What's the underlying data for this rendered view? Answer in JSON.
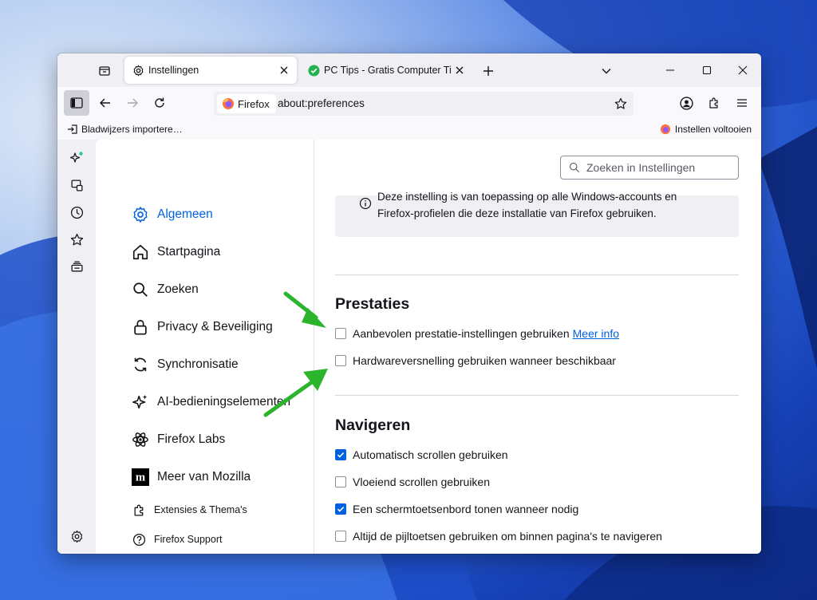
{
  "colors": {
    "accent": "#0061e0",
    "arrow": "#2db42d",
    "tab_check": "#22b14c"
  },
  "tabs": [
    {
      "title": "Instellingen",
      "icon": "gear-icon",
      "active": true
    },
    {
      "title": "PC Tips - Gratis Computer Tips,",
      "icon": "check-circle-icon",
      "active": false
    }
  ],
  "urlbar": {
    "identity_label": "Firefox",
    "url": "about:preferences"
  },
  "bookmarks": {
    "import_label": "Bladwijzers importere…",
    "finish_setup_label": "Instellen voltooien"
  },
  "categories": [
    {
      "label": "Algemeen",
      "icon": "gear-icon",
      "selected": true
    },
    {
      "label": "Startpagina",
      "icon": "home-icon"
    },
    {
      "label": "Zoeken",
      "icon": "search-icon"
    },
    {
      "label": "Privacy & Beveiliging",
      "icon": "lock-icon"
    },
    {
      "label": "Synchronisatie",
      "icon": "sync-icon"
    },
    {
      "label": "AI-bedieningselementen",
      "icon": "sparkle-icon"
    },
    {
      "label": "Firefox Labs",
      "icon": "labs-icon"
    },
    {
      "label": "Meer van Mozilla",
      "icon": "mozilla-icon"
    },
    {
      "label": "Extensies & Thema's",
      "icon": "puzzle-icon"
    },
    {
      "label": "Firefox Support",
      "icon": "help-icon"
    }
  ],
  "search": {
    "placeholder": "Zoeken in Instellingen"
  },
  "info": {
    "line1": "Deze instelling is van toepassing op alle Windows-accounts en",
    "line2": "Firefox-profielen die deze installatie van Firefox gebruiken."
  },
  "performance": {
    "heading": "Prestaties",
    "recommended_label": "Aanbevolen prestatie-instellingen gebruiken",
    "recommended_link": "Meer info",
    "recommended_checked": false,
    "hw_label": "Hardwareversnelling gebruiken wanneer beschikbaar",
    "hw_checked": false
  },
  "navigation": {
    "heading": "Navigeren",
    "options": [
      {
        "label": "Automatisch scrollen gebruiken",
        "checked": true
      },
      {
        "label": "Vloeiend scrollen gebruiken",
        "checked": false
      },
      {
        "label": "Een schermtoetsenbord tonen wanneer nodig",
        "checked": true
      },
      {
        "label": "Altijd de pijltoetsen gebruiken om binnen pagina's te navigeren",
        "checked": false
      }
    ]
  }
}
